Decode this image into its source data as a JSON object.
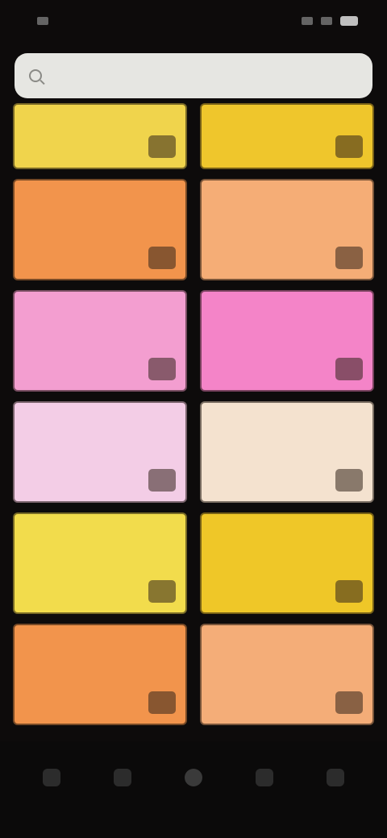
{
  "status_bar": {
    "time": "",
    "icons": [
      "signal-icon",
      "wifi-icon",
      "battery-icon"
    ]
  },
  "search": {
    "placeholder": "",
    "value": ""
  },
  "tiles": [
    {
      "label": "",
      "color": "#f0d44c",
      "icon": "tile-icon"
    },
    {
      "label": "",
      "color": "#efc62c",
      "icon": "tile-icon"
    },
    {
      "label": "",
      "color": "#f2944c",
      "icon": "tile-icon"
    },
    {
      "label": "",
      "color": "#f5ad76",
      "icon": "tile-icon"
    },
    {
      "label": "",
      "color": "#f39ed0",
      "icon": "tile-icon"
    },
    {
      "label": "",
      "color": "#f484c8",
      "icon": "tile-icon"
    },
    {
      "label": "",
      "color": "#f3cde6",
      "icon": "tile-icon"
    },
    {
      "label": "",
      "color": "#f4e2cf",
      "icon": "tile-icon"
    },
    {
      "label": "",
      "color": "#f2dc4c",
      "icon": "tile-icon"
    },
    {
      "label": "",
      "color": "#efc728",
      "icon": "tile-icon"
    },
    {
      "label": "",
      "color": "#f2944c",
      "icon": "tile-icon"
    },
    {
      "label": "",
      "color": "#f4ad78",
      "icon": "tile-icon"
    }
  ],
  "nav": {
    "items": [
      {
        "icon": "home-icon"
      },
      {
        "icon": "grid-icon"
      },
      {
        "icon": "circle-icon",
        "active": true
      },
      {
        "icon": "list-icon"
      },
      {
        "icon": "profile-icon"
      }
    ]
  }
}
